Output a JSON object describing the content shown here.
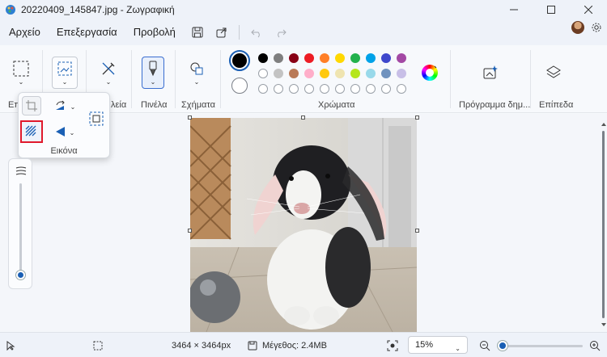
{
  "window": {
    "title": "20220409_145847.jpg - Ζωγραφική"
  },
  "menu": {
    "items": [
      "Αρχείο",
      "Επεξεργασία",
      "Προβολή"
    ]
  },
  "ribbon": {
    "groups": {
      "edit_partial": "Επ",
      "tools_partial": "λεία",
      "brushes": "Πινέλα",
      "shapes": "Σχήματα",
      "colors": "Χρώματα",
      "creator": "Πρόγραμμα δημ...",
      "layers": "Επίπεδα"
    },
    "image_popup_label": "Εικόνα",
    "palette_row1": [
      "#000000",
      "#7f7f7f",
      "#880015",
      "#ed1c24",
      "#ff7f27",
      "#ffd800",
      "#22b14c",
      "#00a2e8",
      "#3f48cc",
      "#a349a4"
    ],
    "palette_row2": [
      "#ffffff",
      "#c3c3c3",
      "#b97a57",
      "#ffaec9",
      "#ffc90e",
      "#efe4b0",
      "#b5e61d",
      "#99d9ea",
      "#7092be",
      "#c8bfe7"
    ],
    "primary_color": "#000000",
    "secondary_color": "#ffffff",
    "accent": "#1a5fb4"
  },
  "status": {
    "dimensions": "3464 × 3464px",
    "size": "Μέγεθος: 2.4MB",
    "zoom": "15%"
  },
  "icons": [
    "paint-app-icon",
    "minimize-icon",
    "maximize-icon",
    "close-icon",
    "save-icon",
    "share-icon",
    "undo-icon",
    "redo-icon",
    "avatar",
    "settings-icon",
    "selection-icon",
    "image-icon",
    "tools-icon",
    "brush-icon",
    "shapes-icon",
    "color-picker-icon",
    "creator-icon",
    "layers-icon",
    "crop-icon",
    "rotate-icon",
    "resize-icon",
    "flip-icon",
    "background-remove-icon",
    "pointer-icon",
    "zoom-out-icon",
    "zoom-in-icon"
  ]
}
